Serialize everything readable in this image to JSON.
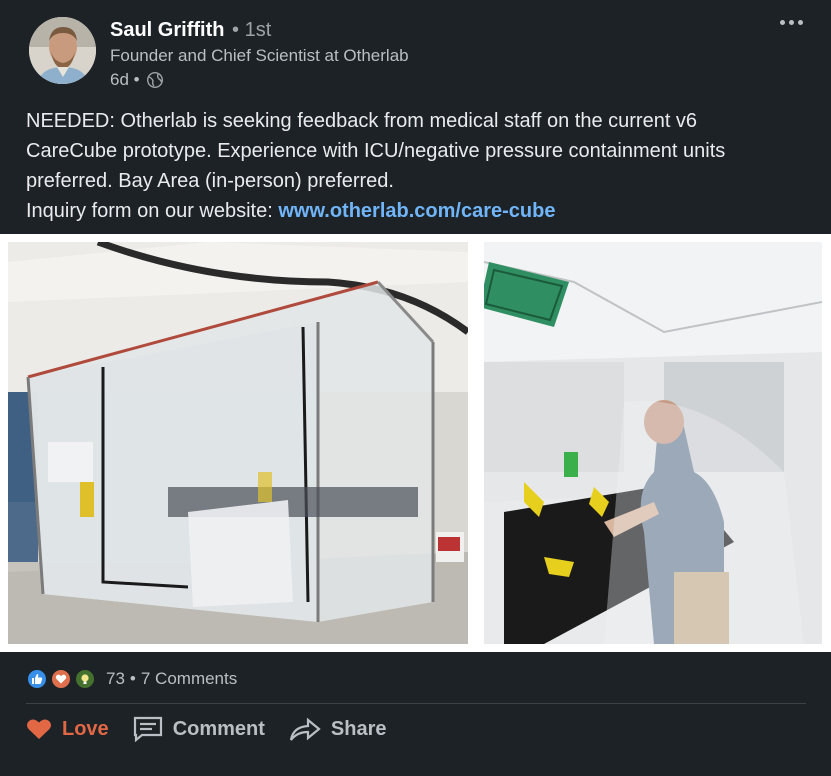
{
  "author": {
    "name": "Saul Griffith",
    "degree": "• 1st",
    "headline": "Founder and Chief Scientist at Otherlab",
    "time": "6d •",
    "visibility_icon": "globe-icon"
  },
  "post": {
    "lines": [
      "NEEDED: Otherlab is seeking feedback from medical staff on the current v6",
      "CareCube prototype. Experience with ICU/negative pressure containment units",
      "preferred. Bay Area (in-person) preferred."
    ],
    "link_prefix": "Inquiry form on our website: ",
    "link_text": "www.otherlab.com/care-cube"
  },
  "social": {
    "reactions": [
      "like-icon",
      "love-icon",
      "insightful-icon"
    ],
    "count": "73",
    "separator": "•",
    "comments": "7 Comments"
  },
  "actions": {
    "love": "Love",
    "comment": "Comment",
    "share": "Share"
  },
  "colors": {
    "background": "#1d2226",
    "link": "#70b5f9",
    "love_active": "#e16745",
    "like_badge": "#378fe9",
    "love_badge": "#df704d",
    "insight_badge": "#44712e"
  }
}
